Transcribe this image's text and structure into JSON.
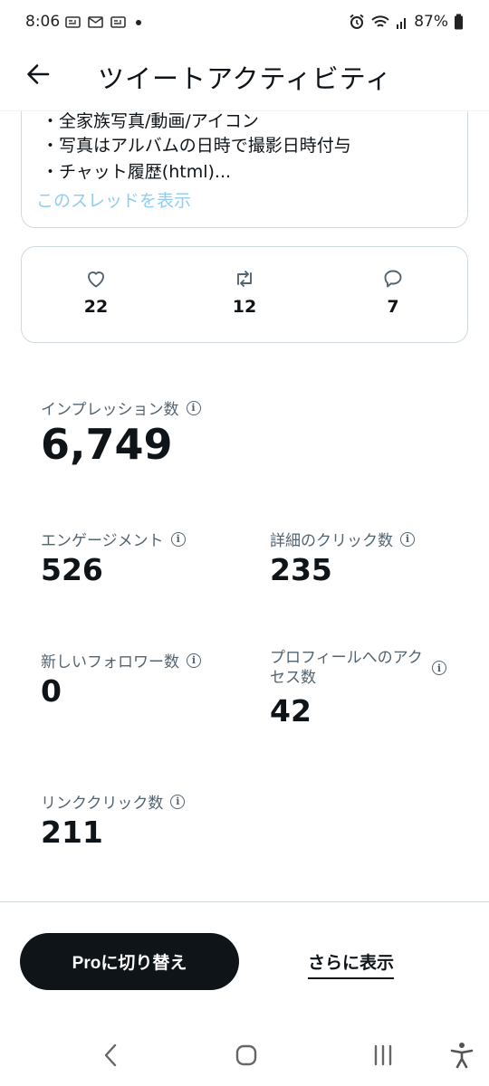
{
  "status_bar": {
    "time": "8:06",
    "battery": "87%"
  },
  "header": {
    "title": "ツイートアクティビティ"
  },
  "tweet": {
    "lines": [
      "・全家族写真/動画/アイコン",
      "・写真はアルバムの日時で撮影日時付与",
      "・チャット履歴(html)..."
    ],
    "show_thread": "このスレッドを表示"
  },
  "engagement": {
    "likes": "22",
    "retweets": "12",
    "replies": "7"
  },
  "metrics": {
    "impressions": {
      "label": "インプレッション数",
      "value": "6,749"
    },
    "engagements": {
      "label": "エンゲージメント",
      "value": "526"
    },
    "detail_clicks": {
      "label": "詳細のクリック数",
      "value": "235"
    },
    "new_followers": {
      "label": "新しいフォロワー数",
      "value": "0"
    },
    "profile_visits": {
      "label": "プロフィールへのアクセス数",
      "label_line1": "プロフィールへのアク",
      "label_line2": "セス数",
      "value": "42"
    },
    "link_clicks": {
      "label": "リンククリック数",
      "value": "211"
    }
  },
  "actions": {
    "pro_button": "Proに切り替え",
    "show_more": "さらに表示"
  },
  "colors": {
    "text": "#0f1419",
    "secondary": "#536471",
    "link": "#8fcdf2",
    "border": "#cfd9de"
  }
}
